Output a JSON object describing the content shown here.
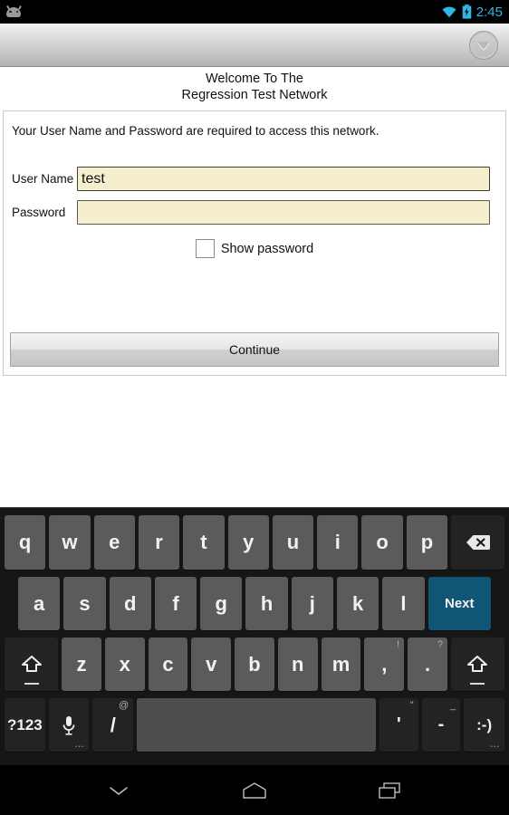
{
  "status_bar": {
    "notification_icon": "android-robot-icon",
    "wifi_icon": "wifi-icon",
    "battery_icon": "battery-charging-icon",
    "time": "2:45",
    "accent_color": "#33b5e5"
  },
  "toolbar": {
    "dropdown_icon": "chevron-down-circle-icon"
  },
  "page": {
    "title_line1": "Welcome To The",
    "title_line2": "Regression Test Network",
    "instructions": "Your User Name and Password are required to access this network.",
    "form": {
      "username_label": "User Name",
      "username_value": "test",
      "username_placeholder": "",
      "password_label": "Password",
      "password_value": "",
      "password_placeholder": "",
      "show_password_label": "Show password",
      "show_password_checked": false,
      "field_bg_color": "#f5efcd"
    },
    "continue_label": "Continue"
  },
  "keyboard": {
    "row1": [
      {
        "label": "q"
      },
      {
        "label": "w"
      },
      {
        "label": "e"
      },
      {
        "label": "r"
      },
      {
        "label": "t"
      },
      {
        "label": "y"
      },
      {
        "label": "u"
      },
      {
        "label": "i"
      },
      {
        "label": "o"
      },
      {
        "label": "p"
      }
    ],
    "backspace": {
      "name": "backspace-key",
      "label": ""
    },
    "row2": [
      {
        "label": "a"
      },
      {
        "label": "s"
      },
      {
        "label": "d"
      },
      {
        "label": "f"
      },
      {
        "label": "g"
      },
      {
        "label": "h"
      },
      {
        "label": "j"
      },
      {
        "label": "k"
      },
      {
        "label": "l"
      }
    ],
    "next_key_label": "Next",
    "next_key_color": "#0f5575",
    "row3": [
      {
        "label": "z"
      },
      {
        "label": "x"
      },
      {
        "label": "c"
      },
      {
        "label": "v"
      },
      {
        "label": "b"
      },
      {
        "label": "n"
      },
      {
        "label": "m"
      },
      {
        "label": ",",
        "hint": "!"
      },
      {
        "label": ".",
        "hint": "?"
      }
    ],
    "shift_left": {
      "name": "shift-key"
    },
    "shift_right": {
      "name": "shift-key"
    },
    "row4": {
      "symbols_label": "?123",
      "mic_label": "",
      "mic_hint": "...",
      "slash_label": "/",
      "slash_hint": "@",
      "space_label": "",
      "apostrophe_label": "'",
      "apostrophe_hint": "\"",
      "dash_label": "-",
      "dash_hint": "_",
      "smiley_label": ":-)",
      "smiley_hint": "..."
    }
  },
  "nav_bar": {
    "back_icon": "chevron-down-icon",
    "home_icon": "home-icon",
    "recents_icon": "recent-apps-icon"
  }
}
